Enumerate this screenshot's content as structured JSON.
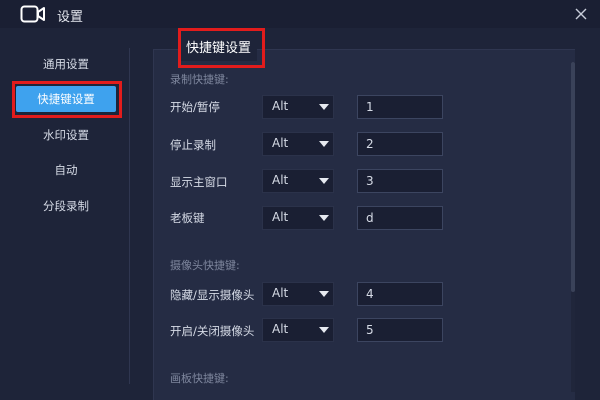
{
  "window": {
    "title": "设置",
    "icon": "video-camera-icon",
    "close_icon": "close-icon"
  },
  "sidebar": {
    "items": [
      {
        "label": "通用设置",
        "active": false
      },
      {
        "label": "快捷键设置",
        "active": true
      },
      {
        "label": "水印设置",
        "active": false
      },
      {
        "label": "自动",
        "active": false
      },
      {
        "label": "分段录制",
        "active": false
      }
    ]
  },
  "panel": {
    "title": "快捷键设置",
    "sections": [
      {
        "label": "录制快捷键:",
        "rows": [
          {
            "label": "开始/暂停",
            "modifier": "Alt",
            "key": "1"
          },
          {
            "label": "停止录制",
            "modifier": "Alt",
            "key": "2"
          },
          {
            "label": "显示主窗口",
            "modifier": "Alt",
            "key": "3"
          },
          {
            "label": "老板键",
            "modifier": "Alt",
            "key": "d"
          }
        ]
      },
      {
        "label": "摄像头快捷键:",
        "rows": [
          {
            "label": "隐藏/显示摄像头",
            "modifier": "Alt",
            "key": "4"
          },
          {
            "label": "开启/关闭摄像头",
            "modifier": "Alt",
            "key": "5"
          }
        ]
      },
      {
        "label": "画板快捷键:",
        "rows": []
      }
    ]
  },
  "colors": {
    "background": "#1e2439",
    "active_item": "#3ea2ee",
    "highlight": "#e21c1c"
  }
}
